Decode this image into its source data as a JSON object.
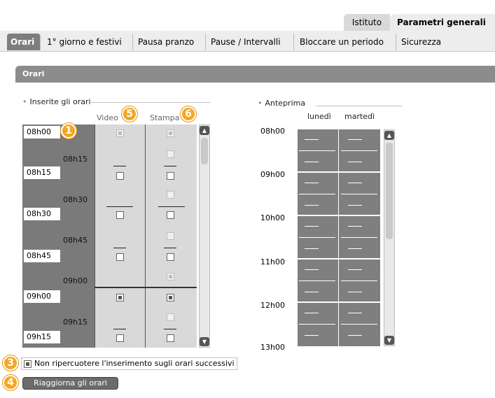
{
  "top_tabs": [
    {
      "label": "Istituto"
    },
    {
      "label": "Parametri generali"
    }
  ],
  "sub_tabs": [
    {
      "label": "Orari"
    },
    {
      "label": "1° giorno e festivi"
    },
    {
      "label": "Pausa pranzo"
    },
    {
      "label": "Pause / Intervalli"
    },
    {
      "label": "Bloccare un periodo"
    },
    {
      "label": "Sicurezza"
    }
  ],
  "section_title": "Orari",
  "inserite": {
    "title": "Inserite gli orari",
    "col_video": "Video",
    "col_stampa": "Stampa",
    "white_times": [
      "08h00",
      "08h15",
      "08h30",
      "08h45",
      "09h00",
      "09h15"
    ],
    "gray_times": [
      "08h15",
      "08h30",
      "08h45",
      "09h00",
      "09h15"
    ]
  },
  "anteprima": {
    "title": "Anteprima",
    "days": [
      "lunedì",
      "martedì"
    ],
    "times": [
      "08h00",
      "09h00",
      "10h00",
      "11h00",
      "12h00",
      "13h00"
    ]
  },
  "badges": [
    "1",
    "5",
    "6",
    "3",
    "4"
  ],
  "option_label": "Non ripercuotere l'inserimento sugli orari successivi",
  "refresh_button": "Riaggiorna gli orari",
  "icons": {
    "scroll_up": "scroll-up-arrow-icon",
    "scroll_down": "scroll-down-arrow-icon",
    "bullet": "bullet-dot-icon"
  },
  "colors": {
    "badge": "#f5a623",
    "active_tab": "#7d7d7d",
    "section_bar": "#8c8c8c"
  }
}
